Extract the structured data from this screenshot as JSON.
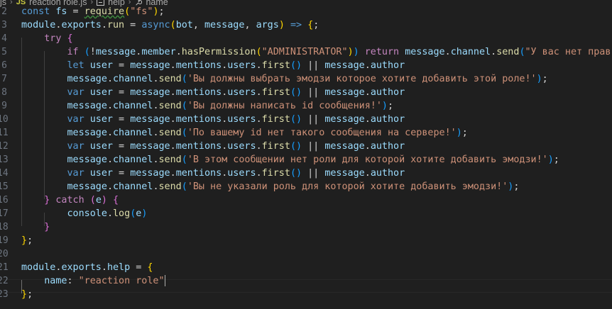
{
  "breadcrumb": {
    "folder": "js",
    "file_badge": "JS",
    "file": "reaction role.js",
    "symbol1": "help",
    "symbol2": "name"
  },
  "lines": [
    {
      "num": "2",
      "tokens": [
        [
          "kw",
          "const"
        ],
        [
          "punc",
          " "
        ],
        [
          "var",
          "fs"
        ],
        [
          "punc",
          " = "
        ],
        [
          "fn",
          "require"
        ],
        [
          "brk1",
          "("
        ],
        [
          "str",
          "\"fs\""
        ],
        [
          "brk1",
          ")"
        ],
        [
          "punc",
          ";"
        ]
      ]
    },
    {
      "num": "3",
      "tokens": [
        [
          "var",
          "module"
        ],
        [
          "punc",
          "."
        ],
        [
          "var",
          "exports"
        ],
        [
          "punc",
          "."
        ],
        [
          "fn",
          "run"
        ],
        [
          "punc",
          " = "
        ],
        [
          "kw",
          "async"
        ],
        [
          "brk1",
          "("
        ],
        [
          "var",
          "bot"
        ],
        [
          "punc",
          ", "
        ],
        [
          "var",
          "message"
        ],
        [
          "punc",
          ", "
        ],
        [
          "var",
          "args"
        ],
        [
          "brk1",
          ")"
        ],
        [
          "punc",
          " "
        ],
        [
          "kw",
          "=>"
        ],
        [
          "punc",
          " "
        ],
        [
          "brk1",
          "{"
        ],
        [
          "punc",
          ";"
        ]
      ]
    },
    {
      "num": "4",
      "tokens": [
        [
          "punc",
          "    "
        ],
        [
          "kw2",
          "try"
        ],
        [
          "punc",
          " "
        ],
        [
          "brk2",
          "{"
        ]
      ]
    },
    {
      "num": "5",
      "tokens": [
        [
          "punc",
          "        "
        ],
        [
          "kw2",
          "if"
        ],
        [
          "punc",
          " "
        ],
        [
          "brk3",
          "("
        ],
        [
          "punc",
          "!"
        ],
        [
          "var",
          "message"
        ],
        [
          "punc",
          "."
        ],
        [
          "var",
          "member"
        ],
        [
          "punc",
          "."
        ],
        [
          "fn",
          "hasPermission"
        ],
        [
          "brk1",
          "("
        ],
        [
          "str",
          "\"ADMINISTRATOR\""
        ],
        [
          "brk1",
          ")"
        ],
        [
          "brk3",
          ")"
        ],
        [
          "punc",
          " "
        ],
        [
          "kw2",
          "return"
        ],
        [
          "punc",
          " "
        ],
        [
          "var",
          "message"
        ],
        [
          "punc",
          "."
        ],
        [
          "var",
          "channel"
        ],
        [
          "punc",
          "."
        ],
        [
          "fn",
          "send"
        ],
        [
          "brk3",
          "("
        ],
        [
          "str",
          "\"У вас нет прав\""
        ],
        [
          "brk3",
          ")"
        ],
        [
          "punc",
          ";"
        ]
      ]
    },
    {
      "num": "6",
      "tokens": [
        [
          "punc",
          "        "
        ],
        [
          "kw",
          "let"
        ],
        [
          "punc",
          " "
        ],
        [
          "var",
          "user"
        ],
        [
          "punc",
          " = "
        ],
        [
          "var",
          "message"
        ],
        [
          "punc",
          "."
        ],
        [
          "var",
          "mentions"
        ],
        [
          "punc",
          "."
        ],
        [
          "var",
          "users"
        ],
        [
          "punc",
          "."
        ],
        [
          "fn",
          "first"
        ],
        [
          "brk3",
          "()"
        ],
        [
          "punc",
          " || "
        ],
        [
          "var",
          "message"
        ],
        [
          "punc",
          "."
        ],
        [
          "var",
          "author"
        ]
      ]
    },
    {
      "num": "7",
      "tokens": [
        [
          "punc",
          "        "
        ],
        [
          "var",
          "message"
        ],
        [
          "punc",
          "."
        ],
        [
          "var",
          "channel"
        ],
        [
          "punc",
          "."
        ],
        [
          "fn",
          "send"
        ],
        [
          "brk3",
          "("
        ],
        [
          "str",
          "'Вы должны выбрать эмодзи которое хотите добавить этой роле!'"
        ],
        [
          "brk3",
          ")"
        ],
        [
          "punc",
          ";"
        ]
      ]
    },
    {
      "num": "8",
      "tokens": [
        [
          "punc",
          "        "
        ],
        [
          "kw",
          "var"
        ],
        [
          "punc",
          " "
        ],
        [
          "var",
          "user"
        ],
        [
          "punc",
          " = "
        ],
        [
          "var",
          "message"
        ],
        [
          "punc",
          "."
        ],
        [
          "var",
          "mentions"
        ],
        [
          "punc",
          "."
        ],
        [
          "var",
          "users"
        ],
        [
          "punc",
          "."
        ],
        [
          "fn",
          "first"
        ],
        [
          "brk3",
          "()"
        ],
        [
          "punc",
          " || "
        ],
        [
          "var",
          "message"
        ],
        [
          "punc",
          "."
        ],
        [
          "var",
          "author"
        ]
      ]
    },
    {
      "num": "9",
      "tokens": [
        [
          "punc",
          "        "
        ],
        [
          "var",
          "message"
        ],
        [
          "punc",
          "."
        ],
        [
          "var",
          "channel"
        ],
        [
          "punc",
          "."
        ],
        [
          "fn",
          "send"
        ],
        [
          "brk3",
          "("
        ],
        [
          "str",
          "'Вы должны написать id сообщения!'"
        ],
        [
          "brk3",
          ")"
        ],
        [
          "punc",
          ";"
        ]
      ]
    },
    {
      "num": "10",
      "tokens": [
        [
          "punc",
          "        "
        ],
        [
          "kw",
          "var"
        ],
        [
          "punc",
          " "
        ],
        [
          "var",
          "user"
        ],
        [
          "punc",
          " = "
        ],
        [
          "var",
          "message"
        ],
        [
          "punc",
          "."
        ],
        [
          "var",
          "mentions"
        ],
        [
          "punc",
          "."
        ],
        [
          "var",
          "users"
        ],
        [
          "punc",
          "."
        ],
        [
          "fn",
          "first"
        ],
        [
          "brk3",
          "()"
        ],
        [
          "punc",
          " || "
        ],
        [
          "var",
          "message"
        ],
        [
          "punc",
          "."
        ],
        [
          "var",
          "author"
        ]
      ]
    },
    {
      "num": "11",
      "tokens": [
        [
          "punc",
          "        "
        ],
        [
          "var",
          "message"
        ],
        [
          "punc",
          "."
        ],
        [
          "var",
          "channel"
        ],
        [
          "punc",
          "."
        ],
        [
          "fn",
          "send"
        ],
        [
          "brk3",
          "("
        ],
        [
          "str",
          "'По вашему id нет такого сообщения на сервере!'"
        ],
        [
          "brk3",
          ")"
        ],
        [
          "punc",
          ";"
        ]
      ]
    },
    {
      "num": "12",
      "tokens": [
        [
          "punc",
          "        "
        ],
        [
          "kw",
          "var"
        ],
        [
          "punc",
          " "
        ],
        [
          "var",
          "user"
        ],
        [
          "punc",
          " = "
        ],
        [
          "var",
          "message"
        ],
        [
          "punc",
          "."
        ],
        [
          "var",
          "mentions"
        ],
        [
          "punc",
          "."
        ],
        [
          "var",
          "users"
        ],
        [
          "punc",
          "."
        ],
        [
          "fn",
          "first"
        ],
        [
          "brk3",
          "()"
        ],
        [
          "punc",
          " || "
        ],
        [
          "var",
          "message"
        ],
        [
          "punc",
          "."
        ],
        [
          "var",
          "author"
        ]
      ]
    },
    {
      "num": "13",
      "tokens": [
        [
          "punc",
          "        "
        ],
        [
          "var",
          "message"
        ],
        [
          "punc",
          "."
        ],
        [
          "var",
          "channel"
        ],
        [
          "punc",
          "."
        ],
        [
          "fn",
          "send"
        ],
        [
          "brk3",
          "("
        ],
        [
          "str",
          "'В этом сообщении нет роли для которой хотите добавить эмодзи!'"
        ],
        [
          "brk3",
          ")"
        ],
        [
          "punc",
          ";"
        ]
      ]
    },
    {
      "num": "14",
      "tokens": [
        [
          "punc",
          "        "
        ],
        [
          "kw",
          "var"
        ],
        [
          "punc",
          " "
        ],
        [
          "var",
          "user"
        ],
        [
          "punc",
          " = "
        ],
        [
          "var",
          "message"
        ],
        [
          "punc",
          "."
        ],
        [
          "var",
          "mentions"
        ],
        [
          "punc",
          "."
        ],
        [
          "var",
          "users"
        ],
        [
          "punc",
          "."
        ],
        [
          "fn",
          "first"
        ],
        [
          "brk3",
          "()"
        ],
        [
          "punc",
          " || "
        ],
        [
          "var",
          "message"
        ],
        [
          "punc",
          "."
        ],
        [
          "var",
          "author"
        ]
      ]
    },
    {
      "num": "15",
      "tokens": [
        [
          "punc",
          "        "
        ],
        [
          "var",
          "message"
        ],
        [
          "punc",
          "."
        ],
        [
          "var",
          "channel"
        ],
        [
          "punc",
          "."
        ],
        [
          "fn",
          "send"
        ],
        [
          "brk3",
          "("
        ],
        [
          "str",
          "'Вы не указали роль для которой хотите добавить эмодзи!'"
        ],
        [
          "brk3",
          ")"
        ],
        [
          "punc",
          ";"
        ]
      ]
    },
    {
      "num": "16",
      "tokens": [
        [
          "punc",
          "    "
        ],
        [
          "brk2",
          "}"
        ],
        [
          "punc",
          " "
        ],
        [
          "kw2",
          "catch"
        ],
        [
          "punc",
          " "
        ],
        [
          "brk2",
          "("
        ],
        [
          "var",
          "e"
        ],
        [
          "brk2",
          ")"
        ],
        [
          "punc",
          " "
        ],
        [
          "brk2",
          "{"
        ]
      ]
    },
    {
      "num": "17",
      "tokens": [
        [
          "punc",
          "        "
        ],
        [
          "var",
          "console"
        ],
        [
          "punc",
          "."
        ],
        [
          "fn",
          "log"
        ],
        [
          "brk3",
          "("
        ],
        [
          "var",
          "e"
        ],
        [
          "brk3",
          ")"
        ]
      ]
    },
    {
      "num": "18",
      "tokens": [
        [
          "punc",
          "    "
        ],
        [
          "brk2",
          "}"
        ]
      ]
    },
    {
      "num": "19",
      "tokens": [
        [
          "brk1",
          "}"
        ],
        [
          "punc",
          ";"
        ]
      ]
    },
    {
      "num": "20",
      "tokens": []
    },
    {
      "num": "21",
      "tokens": [
        [
          "var",
          "module"
        ],
        [
          "punc",
          "."
        ],
        [
          "var",
          "exports"
        ],
        [
          "punc",
          "."
        ],
        [
          "var",
          "help"
        ],
        [
          "punc",
          " = "
        ],
        [
          "brk1",
          "{"
        ]
      ]
    },
    {
      "num": "22",
      "tokens": [
        [
          "punc",
          "    "
        ],
        [
          "var",
          "name"
        ],
        [
          "punc",
          ": "
        ],
        [
          "str",
          "\"reaction role\""
        ]
      ]
    },
    {
      "num": "23",
      "tokens": [
        [
          "brk1",
          "}"
        ],
        [
          "punc",
          ";"
        ]
      ]
    }
  ],
  "colors": {
    "background": "#1f1f1f",
    "keyword": "#569cd6",
    "control": "#c586c0",
    "variable": "#9cdcfe",
    "function": "#dcdcaa",
    "string": "#ce9178",
    "bracket1": "#ffd700",
    "bracket2": "#da70d6",
    "bracket3": "#179fff"
  }
}
